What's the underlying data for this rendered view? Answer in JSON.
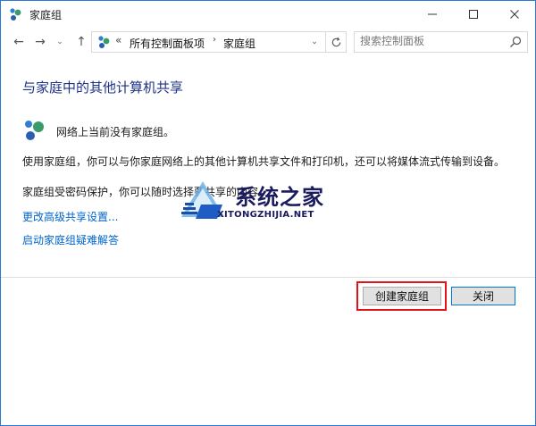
{
  "window": {
    "title": "家庭组"
  },
  "nav": {
    "back": "←",
    "forward": "→",
    "recent": "⌄",
    "up": "↑"
  },
  "address": {
    "overflow": "«",
    "crumb1": "所有控制面板项",
    "separator": "›",
    "crumb2": "家庭组",
    "dropdown": "⌄"
  },
  "search": {
    "placeholder": "搜索控制面板"
  },
  "content": {
    "title": "与家庭中的其他计算机共享",
    "status": "网络上当前没有家庭组。",
    "desc1": "使用家庭组，你可以与你家庭网络上的其他计算机共享文件和打印机，还可以将媒体流式传输到设备。",
    "desc2": "家庭组受密码保护，你可以随时选择要共享的内容。",
    "link_advanced": "更改高级共享设置...",
    "link_troubleshoot": "启动家庭组疑难解答"
  },
  "buttons": {
    "create": "创建家庭组",
    "close": "关闭"
  },
  "watermark": {
    "cn": "系统之家",
    "en": "XITONGZHIJIA.NET"
  },
  "colors": {
    "accent": "#2b78d4",
    "link": "#0066cc",
    "title": "#1e3287",
    "highlight": "#e1141b"
  },
  "icons": {
    "app": "homegroup-icon",
    "search": "search-icon",
    "refresh": "refresh-icon"
  }
}
